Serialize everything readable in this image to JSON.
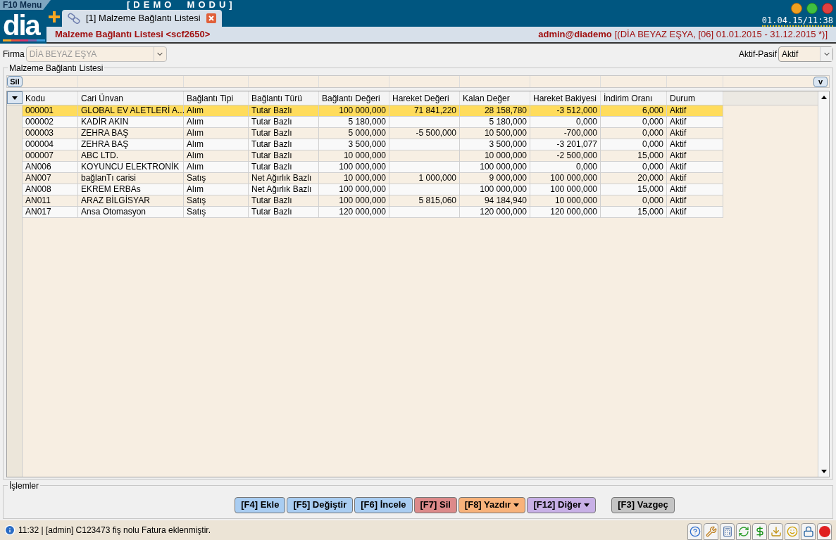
{
  "top_bar": {
    "menu": "F10 Menu",
    "mode": "[DEMO  MODU]",
    "logo": "dia",
    "clock": "01.04.15/11:38"
  },
  "tabs": [
    {
      "label": "[1] Malzeme Bağlantı Listesi",
      "selected": true
    }
  ],
  "header": {
    "title": "Malzeme Bağlantı Listesi <scf2650>",
    "user": "admin@diademo",
    "context": "[(DİA BEYAZ EŞYA, [06] 01.01.2015 - 31.12.2015 *)]"
  },
  "filters": {
    "firma_label": "Firma",
    "firma_value": "DİA BEYAZ EŞYA",
    "firma_disabled": true,
    "aktif_label": "Aktif-Pasif",
    "aktif_value": "Aktif"
  },
  "list": {
    "title": "Malzeme Bağlantı Listesi",
    "filter_button": "Sil",
    "columns_button": "v",
    "columns": [
      "Kodu",
      "Cari Ünvan",
      "Bağlantı Tipi",
      "Bağlantı Türü",
      "Bağlantı Değeri",
      "Hareket Değeri",
      "Kalan Değer",
      "Hareket Bakiyesi",
      "İndirim Oranı",
      "Durum"
    ],
    "rows": [
      {
        "selected": true,
        "cells": [
          "000001",
          "GLOBAL EV ALETLERİ A...",
          "Alım",
          "Tutar Bazlı",
          "100 000,000",
          "71 841,220",
          "28 158,780",
          "-3 512,000",
          "6,000",
          "Aktif"
        ]
      },
      {
        "selected": false,
        "cells": [
          "000002",
          "KADİR AKIN",
          "Alım",
          "Tutar Bazlı",
          "5 180,000",
          "",
          "5 180,000",
          "0,000",
          "0,000",
          "Aktif"
        ]
      },
      {
        "selected": false,
        "cells": [
          "000003",
          "ZEHRA BAŞ",
          "Alım",
          "Tutar Bazlı",
          "5 000,000",
          "-5 500,000",
          "10 500,000",
          "-700,000",
          "0,000",
          "Aktif"
        ]
      },
      {
        "selected": false,
        "cells": [
          "000004",
          "ZEHRA BAŞ",
          "Alım",
          "Tutar Bazlı",
          "3 500,000",
          "",
          "3 500,000",
          "-3 201,077",
          "0,000",
          "Aktif"
        ]
      },
      {
        "selected": false,
        "cells": [
          "000007",
          "ABC LTD.",
          "Alım",
          "Tutar Bazlı",
          "10 000,000",
          "",
          "10 000,000",
          "-2 500,000",
          "15,000",
          "Aktif"
        ]
      },
      {
        "selected": false,
        "cells": [
          "AN006",
          "KOYUNCU ELEKTRONİK",
          "Alım",
          "Tutar Bazlı",
          "100 000,000",
          "",
          "100 000,000",
          "0,000",
          "0,000",
          "Aktif"
        ]
      },
      {
        "selected": false,
        "cells": [
          "AN007",
          "bağlanTı carisi",
          "Satış",
          "Net Ağırlık Bazlı",
          "10 000,000",
          "1 000,000",
          "9 000,000",
          "100 000,000",
          "20,000",
          "Aktif"
        ]
      },
      {
        "selected": false,
        "cells": [
          "AN008",
          "EKREM ERBAs",
          "Alım",
          "Net Ağırlık Bazlı",
          "100 000,000",
          "",
          "100 000,000",
          "100 000,000",
          "15,000",
          "Aktif"
        ]
      },
      {
        "selected": false,
        "cells": [
          "AN011",
          "ARAZ BİLGİSYAR",
          "Satış",
          "Tutar Bazlı",
          "100 000,000",
          "5 815,060",
          "94 184,940",
          "10 000,000",
          "0,000",
          "Aktif"
        ]
      },
      {
        "selected": false,
        "cells": [
          "AN017",
          "Ansa Otomasyon",
          "Satış",
          "Tutar Bazlı",
          "120 000,000",
          "",
          "120 000,000",
          "120 000,000",
          "15,000",
          "Aktif"
        ]
      }
    ]
  },
  "actions": {
    "title": "İşlemler",
    "buttons": [
      {
        "label": "[F4] Ekle",
        "color": "#a9cdf2",
        "has_menu": false
      },
      {
        "label": "[F5] Değiştir",
        "color": "#a9cdf2",
        "has_menu": false
      },
      {
        "label": "[F6] İncele",
        "color": "#a9cdf2",
        "has_menu": false
      },
      {
        "label": "[F7] Sil",
        "color": "#dc8a8a",
        "has_menu": false
      },
      {
        "label": "[F8] Yazdır",
        "color": "#f8b27a",
        "has_menu": true
      },
      {
        "label": "[F12] Diğer",
        "color": "#c8b0e6",
        "has_menu": true
      }
    ],
    "cancel_button": {
      "label": "[F3] Vazgeç",
      "color": "#c4c4c4"
    }
  },
  "status_bar": {
    "message": "11:32 | [admin] C123473 fiş nolu Fatura eklenmiştir."
  }
}
